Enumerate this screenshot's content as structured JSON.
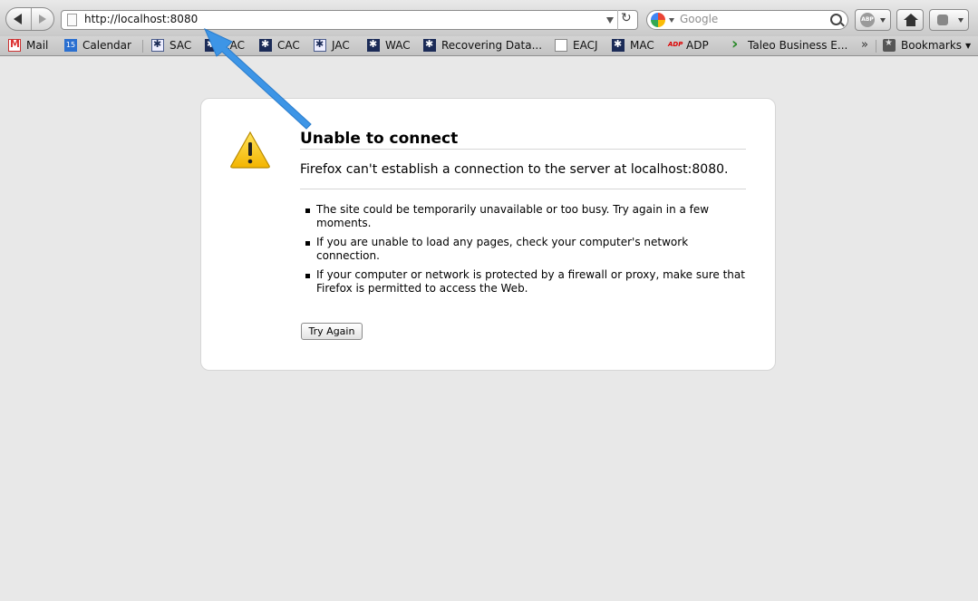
{
  "toolbar": {
    "url": "http://localhost:8080",
    "search_placeholder": "Google",
    "abp_label": "ABP"
  },
  "bookmarks": [
    {
      "label": "Mail",
      "icon": "gmail-icon"
    },
    {
      "label": "Calendar",
      "icon": "calendar-icon",
      "badge": "15"
    },
    {
      "label": "SAC",
      "icon": "sac-icon"
    },
    {
      "label": "EAC",
      "icon": "eac-icon"
    },
    {
      "label": "CAC",
      "icon": "cac-icon"
    },
    {
      "label": "JAC",
      "icon": "jac-icon"
    },
    {
      "label": "WAC",
      "icon": "wac-icon"
    },
    {
      "label": "Recovering Data...",
      "icon": "recovering-data-icon"
    },
    {
      "label": "EACJ",
      "icon": "page-icon"
    },
    {
      "label": "MAC",
      "icon": "mac-icon"
    },
    {
      "label": "ADP",
      "icon": "adp-icon"
    },
    {
      "label": "Taleo Business E...",
      "icon": "taleo-icon"
    },
    {
      "label": "Bookmarks",
      "icon": "bookmarks-icon"
    }
  ],
  "error": {
    "title": "Unable to connect",
    "description": "Firefox can't establish a connection to the server at localhost:8080.",
    "bullets": [
      "The site could be temporarily unavailable or too busy. Try again in a few moments.",
      "If you are unable to load any pages, check your computer's network connection.",
      "If your computer or network is protected by a firewall or proxy, make sure that Firefox is permitted to access the Web."
    ],
    "button": "Try Again"
  },
  "colors": {
    "page_background": "#e8e8e8",
    "annotation_arrow": "#3d95e6",
    "warning_yellow": "#f5c400"
  }
}
